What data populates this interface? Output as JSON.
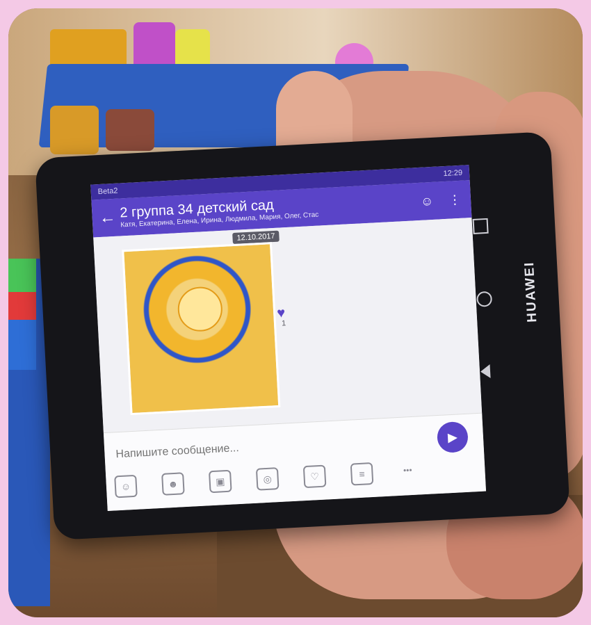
{
  "phone": {
    "brand": "HUAWEI",
    "status": {
      "carrier": "Beta2",
      "indicators": "12:29"
    },
    "chat": {
      "title": "2 группа 34 детский сад",
      "participants": "Катя, Екатерина, Елена, Ирина, Людмила, Мария, Олег, Стас",
      "date": "12.10.2017",
      "likes": "1",
      "composer_placeholder": "Напишите сообщение...",
      "more_label": "•••"
    }
  }
}
